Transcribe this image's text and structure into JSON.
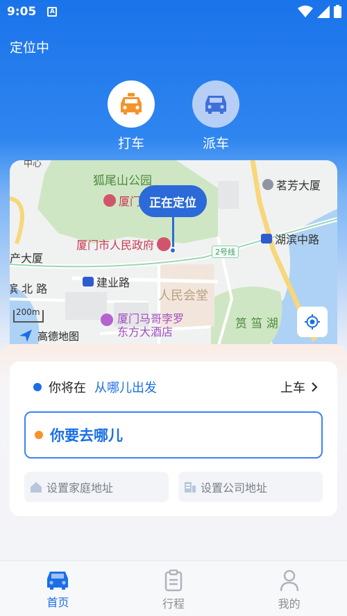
{
  "status": {
    "time": "9:05",
    "notif_icon": "A"
  },
  "header": {
    "location_status": "定位中"
  },
  "modes": [
    {
      "label": "打车",
      "icon": "taxi-icon",
      "color": "#f5932b"
    },
    {
      "label": "派车",
      "icon": "car-icon",
      "color": "#3f6fd8"
    }
  ],
  "map": {
    "pin_label": "正在定位",
    "labels": {
      "park": "狐尾山公园",
      "gov_partial": "厦门",
      "gov": "厦门市人民政府",
      "mingfang": "茗芳大厦",
      "hubin": "湖滨中路",
      "line2": "2号线",
      "chan": "产大厦",
      "binbei": "滨 北 路",
      "jianye": "建业路",
      "hall": "人民会堂",
      "hotel1": "厦门马哥孛罗",
      "hotel2": "东方大酒店",
      "lake": "筼 筜 湖",
      "top_partial": "中心"
    },
    "scale": "200m",
    "brand": "高德地图"
  },
  "trip": {
    "from_prefix": "你将在",
    "from_link": "从哪儿出发",
    "board_label": "上车",
    "dest_placeholder": "你要去哪儿",
    "home_label": "设置家庭地址",
    "work_label": "设置公司地址"
  },
  "tabs": [
    {
      "label": "首页",
      "active": true
    },
    {
      "label": "行程",
      "active": false
    },
    {
      "label": "我的",
      "active": false
    }
  ],
  "colors": {
    "primary": "#1a6fe6",
    "accent": "#f5932b"
  }
}
